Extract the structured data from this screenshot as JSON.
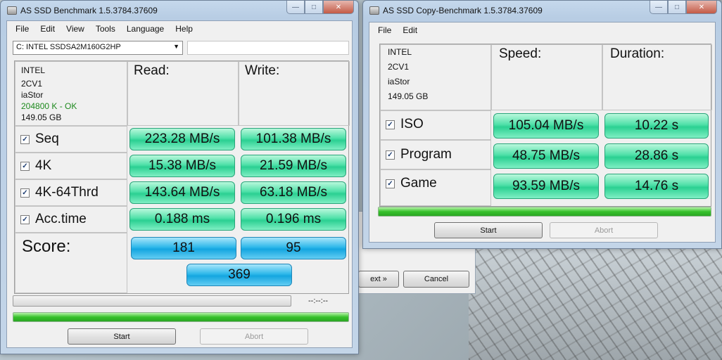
{
  "main_window": {
    "title": "AS SSD Benchmark 1.5.3784.37609",
    "menu": [
      "File",
      "Edit",
      "View",
      "Tools",
      "Language",
      "Help"
    ],
    "drive": "C: INTEL SSDSA2M160G2HP",
    "info": [
      "INTEL",
      "2CV1",
      "iaStor",
      "204800 K - OK",
      "149.05 GB"
    ],
    "read_header": "Read:",
    "write_header": "Write:",
    "rows": [
      {
        "label": "Seq",
        "read": "223.28 MB/s",
        "write": "101.38 MB/s"
      },
      {
        "label": "4K",
        "read": "15.38 MB/s",
        "write": "21.59 MB/s"
      },
      {
        "label": "4K-64Thrd",
        "read": "143.64 MB/s",
        "write": "63.18 MB/s"
      },
      {
        "label": "Acc.time",
        "read": "0.188 ms",
        "write": "0.196 ms"
      }
    ],
    "score_label": "Score:",
    "score_read": "181",
    "score_write": "95",
    "score_total": "369",
    "time_label": "--:--:--",
    "progress_fraction": 1.0,
    "start_label": "Start",
    "abort_label": "Abort"
  },
  "copy_window": {
    "title": "AS SSD Copy-Benchmark 1.5.3784.37609",
    "menu": [
      "File",
      "Edit"
    ],
    "info": [
      "INTEL",
      "2CV1",
      "iaStor",
      "149.05 GB"
    ],
    "speed_header": "Speed:",
    "duration_header": "Duration:",
    "rows": [
      {
        "label": "ISO",
        "speed": "105.04 MB/s",
        "duration": "10.22 s"
      },
      {
        "label": "Program",
        "speed": "48.75 MB/s",
        "duration": "28.86 s"
      },
      {
        "label": "Game",
        "speed": "93.59 MB/s",
        "duration": "14.76 s"
      }
    ],
    "progress_fraction": 1.0,
    "start_label": "Start",
    "abort_label": "Abort"
  },
  "background_dialog": {
    "next_label": "ext »",
    "cancel_label": "Cancel"
  },
  "colors": {
    "result_green": "#2bd092",
    "score_blue": "#14a6e0",
    "progress_green": "#36c12b",
    "ok_text": "#1e8a1e"
  }
}
